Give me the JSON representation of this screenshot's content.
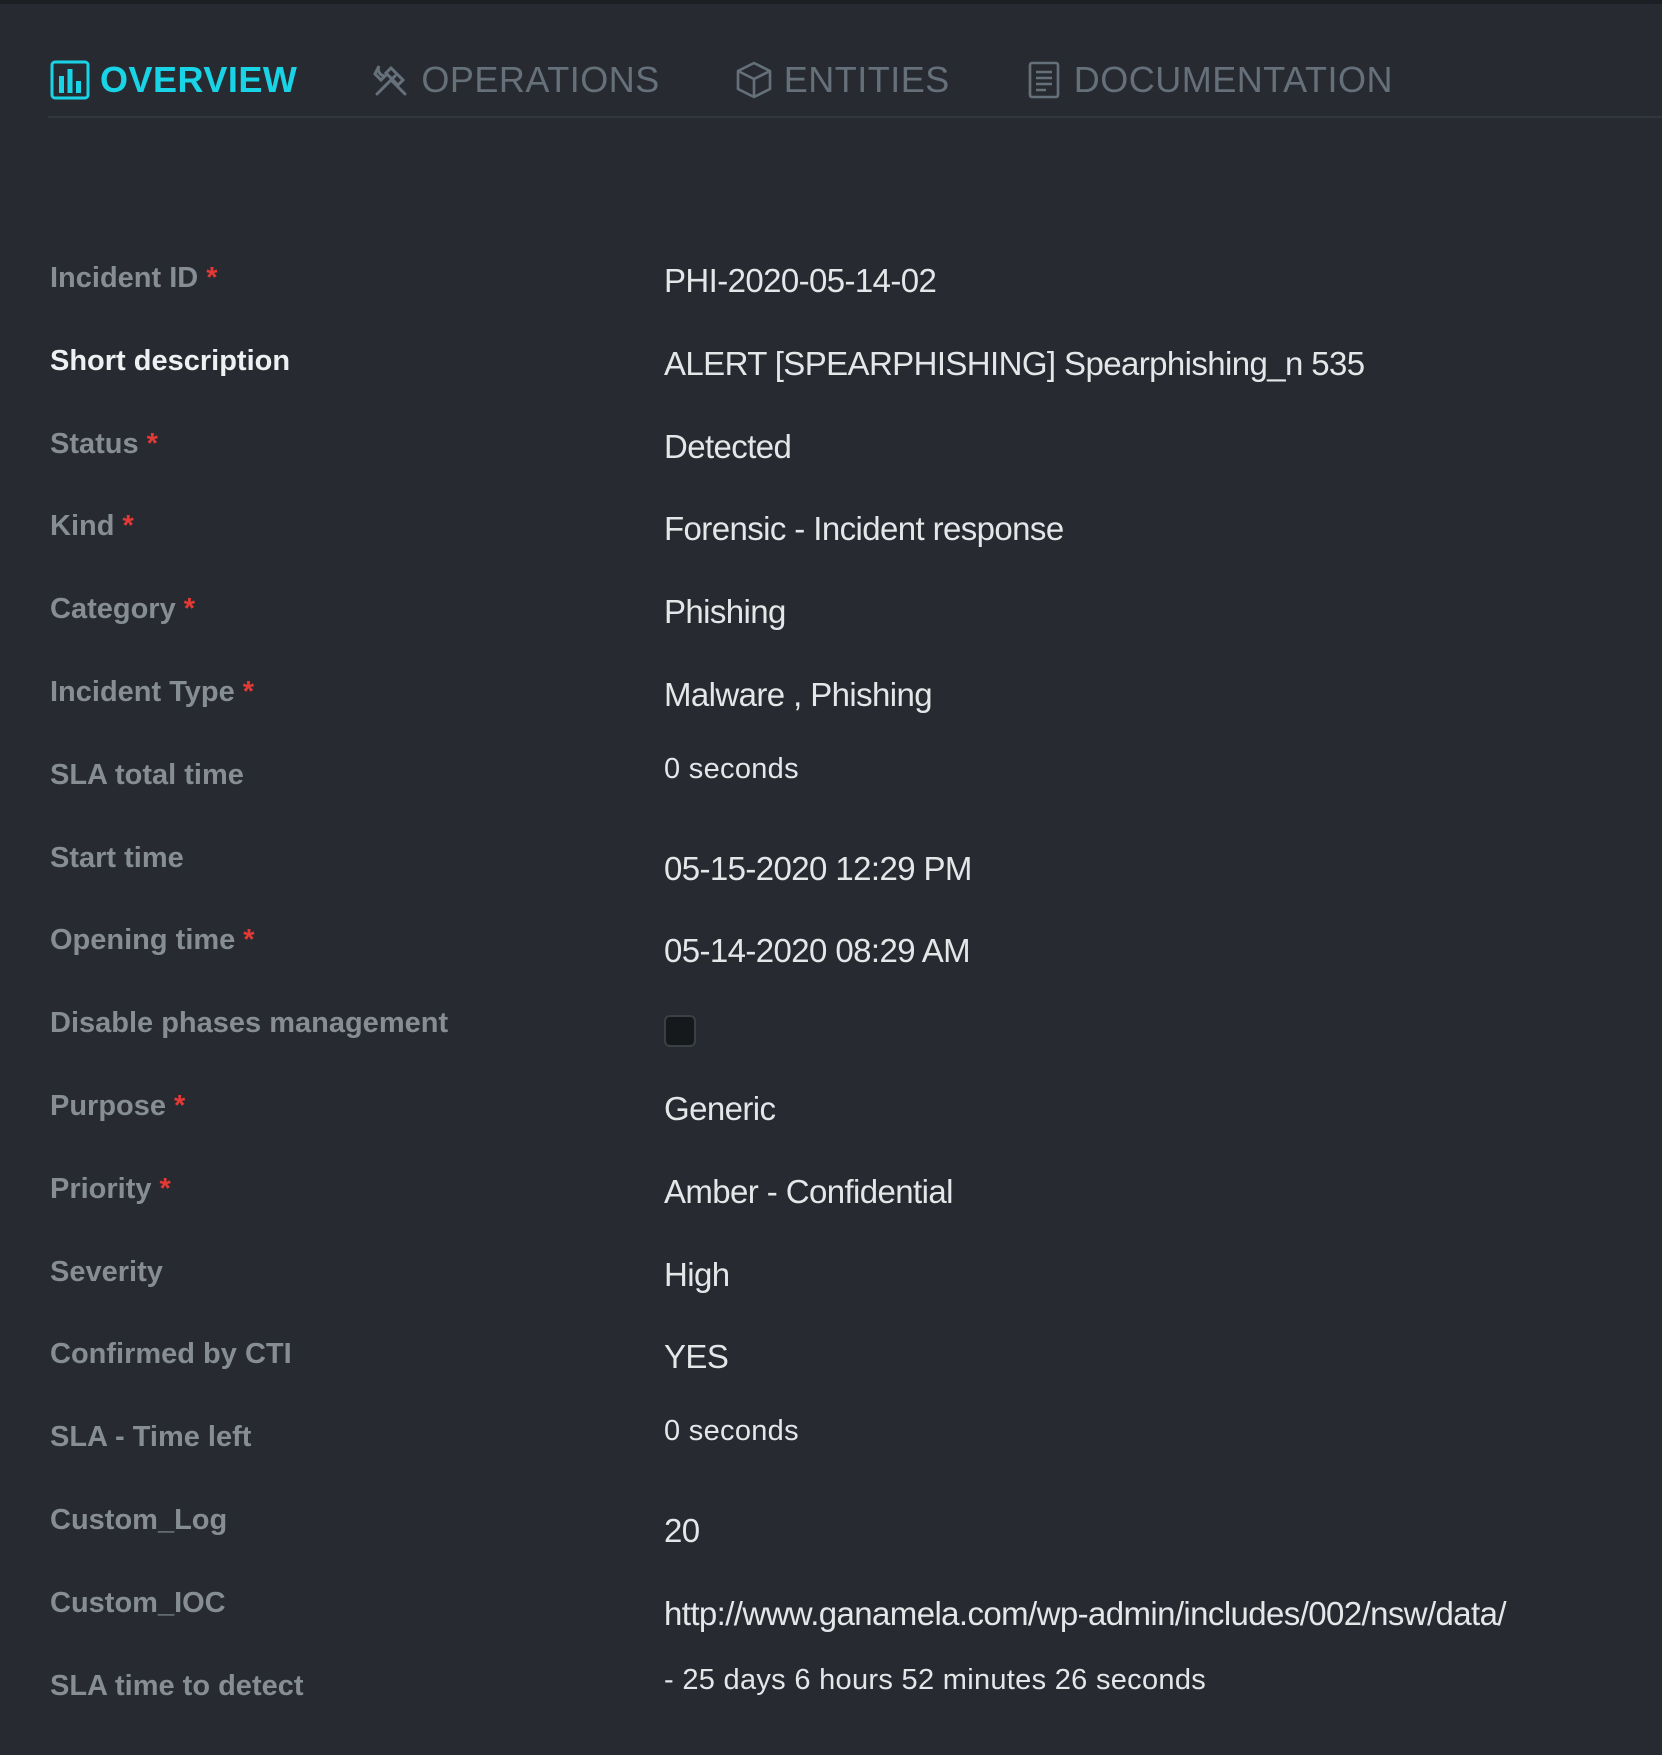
{
  "tabs": [
    {
      "label": "OVERVIEW",
      "icon": "bar-chart-icon",
      "active": true
    },
    {
      "label": "OPERATIONS",
      "icon": "tools-icon",
      "active": false
    },
    {
      "label": "ENTITIES",
      "icon": "cube-icon",
      "active": false
    },
    {
      "label": "DOCUMENTATION",
      "icon": "document-icon",
      "active": false
    }
  ],
  "colors": {
    "accent": "#19d4e6",
    "required": "#e53935",
    "background": "#272b31"
  },
  "fields": [
    {
      "label": "Incident ID",
      "required": "*",
      "value": "PHI-2020-05-14-02"
    },
    {
      "label": "Short description",
      "required": "",
      "value": "ALERT [SPEARPHISHING] Spearphishing_n 535"
    },
    {
      "label": "Status",
      "required": "*",
      "value": "Detected"
    },
    {
      "label": "Kind",
      "required": "*",
      "value": "Forensic - Incident response"
    },
    {
      "label": "Category",
      "required": "*",
      "value": "Phishing"
    },
    {
      "label": "Incident Type",
      "required": "*",
      "value": "Malware , Phishing"
    },
    {
      "label": "SLA total time",
      "required": "",
      "value": "0 seconds"
    },
    {
      "label": "Start time",
      "required": "",
      "value": "05-15-2020 12:29 PM"
    },
    {
      "label": "Opening time",
      "required": "*",
      "value": "05-14-2020 08:29 AM"
    },
    {
      "label": "Disable phases management",
      "required": "",
      "checked": false
    },
    {
      "label": "Purpose",
      "required": "*",
      "value": "Generic"
    },
    {
      "label": "Priority",
      "required": "*",
      "value": "Amber - Confidential"
    },
    {
      "label": "Severity",
      "required": "",
      "value": "High"
    },
    {
      "label": "Confirmed by CTI",
      "required": "",
      "value": "YES"
    },
    {
      "label": "SLA - Time left",
      "required": "",
      "value": "0 seconds"
    },
    {
      "label": "Custom_Log",
      "required": "",
      "value": "20"
    },
    {
      "label": "Custom_IOC",
      "required": "",
      "value": "http://www.ganamela.com/wp-admin/includes/002/nsw/data/"
    },
    {
      "label": "SLA time to detect",
      "required": "",
      "value": "- 25 days 6 hours 52 minutes 26 seconds"
    }
  ]
}
